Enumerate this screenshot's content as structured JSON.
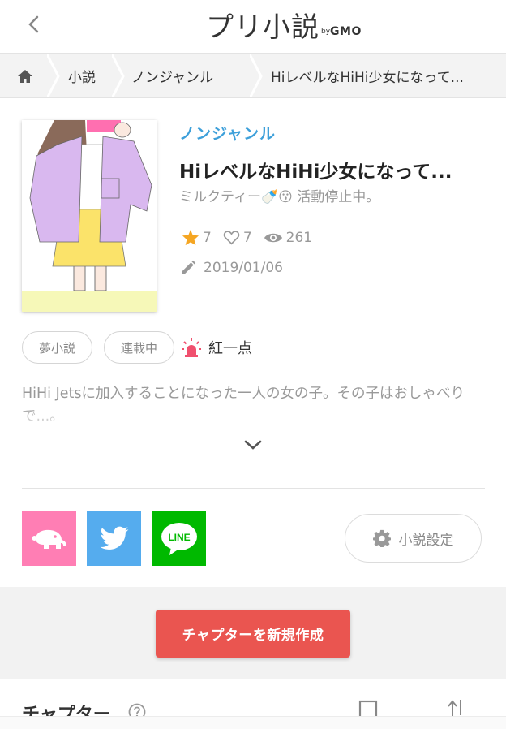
{
  "header": {
    "back_icon": "chevron-left-icon",
    "logo_main": "プリ小説",
    "logo_by": "by",
    "logo_gmo": "GMO"
  },
  "breadcrumb": {
    "home_icon": "home-icon",
    "items": [
      "小説",
      "ノンジャンル",
      "HiレベルなHiHi少女になって..."
    ]
  },
  "novel": {
    "genre": "ノンジャンル",
    "title": "HiレベルなHiHi少女になって...",
    "author": "ミルクティー🍼😗 活動停止中。",
    "stars": "7",
    "likes": "7",
    "views": "261",
    "date": "2019/01/06",
    "tags": [
      "夢小説",
      "連載中"
    ],
    "badge": "紅一点",
    "synopsis": "HiHi Jetsに加入することになった一人の女の子。その子はおしゃべりで...。"
  },
  "share": {
    "prichat_icon": "elephant-icon",
    "twitter_icon": "twitter-bird-icon",
    "line_label": "LINE",
    "settings_label": "小説設定"
  },
  "actions": {
    "create_chapter": "チャプターを新規作成"
  },
  "chapters": {
    "heading": "チャプター"
  },
  "colors": {
    "genre": "#3ea0da",
    "create_button": "#ea5550",
    "prichat": "#ff7eb4",
    "twitter": "#55acee",
    "line": "#00b900",
    "star": "#f5a623"
  }
}
